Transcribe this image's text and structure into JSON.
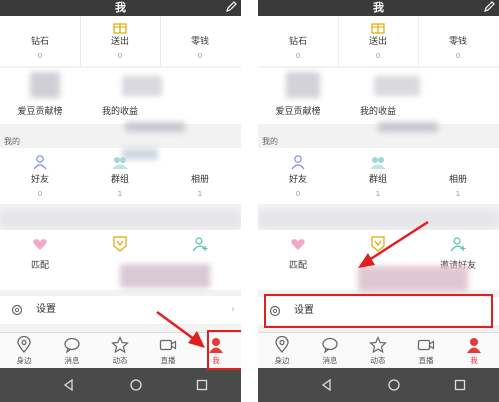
{
  "header": {
    "title": "我"
  },
  "wallet": [
    {
      "label": "钻石",
      "count": "0"
    },
    {
      "label": "送出",
      "count": "0"
    },
    {
      "label": "零钱",
      "count": "0"
    }
  ],
  "ranks": {
    "fans_rank": "爱豆贡献榜",
    "earnings": "我的收益"
  },
  "section": {
    "mine": "我的"
  },
  "social": [
    {
      "label": "好友",
      "count": "0"
    },
    {
      "label": "群组",
      "count": "1"
    },
    {
      "label": "相册",
      "count": "1"
    }
  ],
  "features_left": [
    "匹配"
  ],
  "features_right": [
    "匹配",
    "邀请好友"
  ],
  "settings": {
    "label": "设置"
  },
  "tabs": [
    "身边",
    "消息",
    "动态",
    "直播",
    "我"
  ],
  "colors": {
    "accent": "#e53935",
    "highlight": "#e0201f",
    "topbar": "#3a3a3a"
  }
}
